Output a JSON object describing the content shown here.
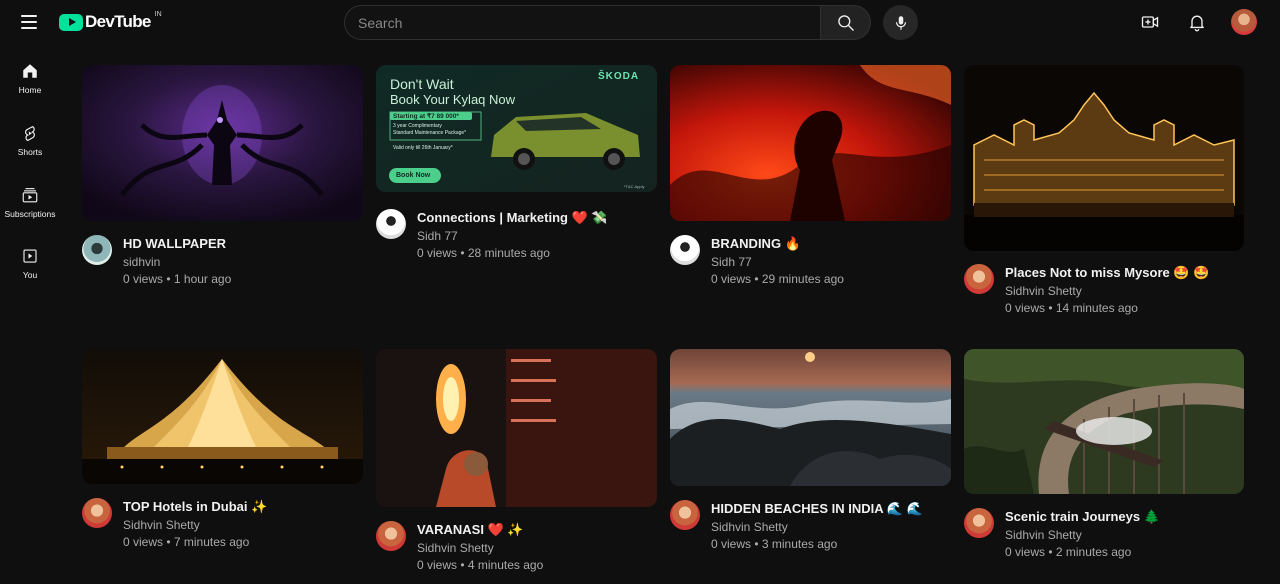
{
  "header": {
    "logo_text": "DevTube",
    "region": "IN",
    "search_placeholder": "Search"
  },
  "sidebar": {
    "items": [
      {
        "label": "Home",
        "icon": "home-icon"
      },
      {
        "label": "Shorts",
        "icon": "shorts-icon"
      },
      {
        "label": "Subscriptions",
        "icon": "subscriptions-icon"
      },
      {
        "label": "You",
        "icon": "you-icon"
      }
    ]
  },
  "videos": [
    {
      "title": "HD WALLPAPER",
      "emoji": "",
      "channel": "sidhvin",
      "stats": "0 views • 1 hour ago"
    },
    {
      "title": "Connections | Marketing",
      "emoji": "❤️ 💸",
      "channel": "Sidh 77",
      "stats": "0 views • 28 minutes ago"
    },
    {
      "title": "BRANDING",
      "emoji": "🔥",
      "channel": "Sidh 77",
      "stats": "0 views • 29 minutes ago"
    },
    {
      "title": "Places Not to miss Mysore",
      "emoji": "🤩 🤩",
      "channel": "Sidhvin Shetty",
      "stats": "0 views • 14 minutes ago"
    },
    {
      "title": "TOP Hotels in Dubai",
      "emoji": "✨",
      "channel": "Sidhvin Shetty",
      "stats": "0 views • 7 minutes ago"
    },
    {
      "title": "VARANASI",
      "emoji": "❤️ ✨",
      "channel": "Sidhvin Shetty",
      "stats": "0 views • 4 minutes ago"
    },
    {
      "title": "HIDDEN BEACHES IN INDIA",
      "emoji": "🌊 🌊",
      "channel": "Sidhvin Shetty",
      "stats": "0 views • 3 minutes ago"
    },
    {
      "title": "Scenic train Journeys",
      "emoji": "🌲",
      "channel": "Sidhvin Shetty",
      "stats": "0 views • 2 minutes ago"
    }
  ],
  "ad": {
    "headline_1": "Don't Wait",
    "headline_2": "Book Your Kylaq Now",
    "brand": "ŠKODA",
    "price": "Starting at ₹7 89 000*",
    "offer_1": "3 year Complimentary",
    "offer_2": "Standard Maintenance Package*",
    "validity": "Valid only till 26th January*",
    "cta": "Book Now",
    "tnc": "*T&C Apply"
  }
}
